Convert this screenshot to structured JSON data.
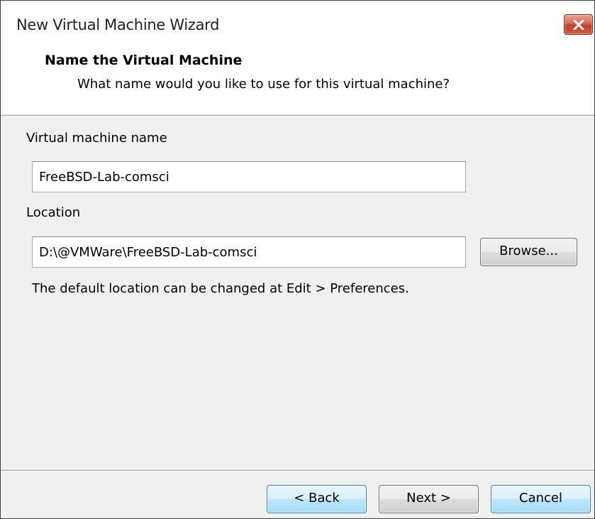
{
  "window": {
    "title": "New Virtual Machine Wizard",
    "close_icon": "close-icon"
  },
  "header": {
    "title": "Name the Virtual Machine",
    "description": "What name would you like to use for this virtual machine?"
  },
  "form": {
    "vm_name_label": "Virtual machine name",
    "vm_name_value": "FreeBSD-Lab-comsci",
    "location_label": "Location",
    "location_value": "D:\\@VMWare\\FreeBSD-Lab-comsci",
    "browse_label": "Browse...",
    "hint": "The default location can be changed at Edit > Preferences."
  },
  "footer": {
    "back_label": "< Back",
    "next_label": "Next >",
    "cancel_label": "Cancel"
  },
  "colors": {
    "close_button": "#c0412a",
    "focused_button": "#a7d9f5"
  }
}
